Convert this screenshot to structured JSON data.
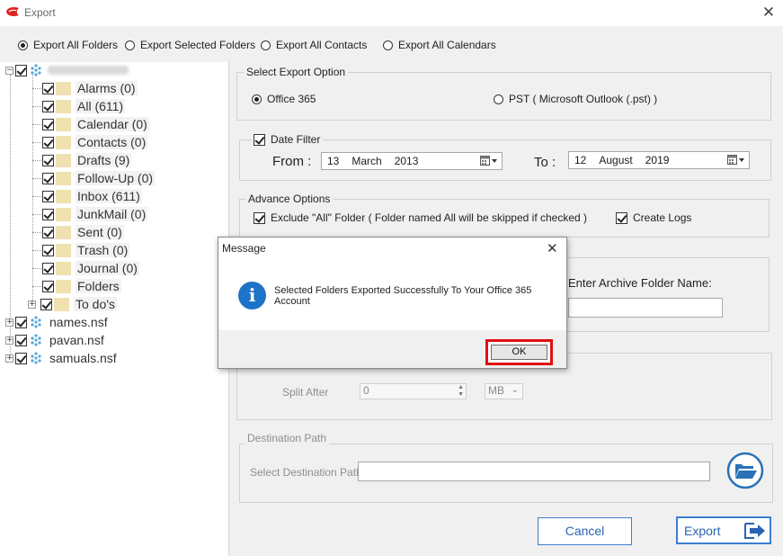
{
  "window": {
    "title": "Export",
    "icon": "app-logo-icon",
    "close_glyph": "✕"
  },
  "export_modes": [
    {
      "label": "Export All Folders",
      "selected": true
    },
    {
      "label": "Export Selected Folders",
      "selected": false
    },
    {
      "label": "Export All Contacts",
      "selected": false
    },
    {
      "label": "Export All Calendars",
      "selected": false
    }
  ],
  "tree": {
    "root": {
      "label_redacted": true,
      "checked": true,
      "expanded": true
    },
    "folders": [
      {
        "label": "Alarms (0)",
        "checked": true
      },
      {
        "label": "All (611)",
        "checked": true
      },
      {
        "label": "Calendar (0)",
        "checked": true
      },
      {
        "label": "Contacts (0)",
        "checked": true
      },
      {
        "label": "Drafts (9)",
        "checked": true
      },
      {
        "label": "Follow-Up (0)",
        "checked": true
      },
      {
        "label": "Inbox (611)",
        "checked": true
      },
      {
        "label": "JunkMail (0)",
        "checked": true
      },
      {
        "label": "Sent (0)",
        "checked": true
      },
      {
        "label": "Trash (0)",
        "checked": true
      },
      {
        "label": "Journal (0)",
        "checked": true
      },
      {
        "label": "Folders",
        "checked": true
      },
      {
        "label": "To do's",
        "checked": true,
        "expandable": true
      }
    ],
    "databases": [
      {
        "label": "names.nsf",
        "checked": true
      },
      {
        "label": "pavan.nsf",
        "checked": true
      },
      {
        "label": "samuals.nsf",
        "checked": true
      }
    ]
  },
  "export_option": {
    "legend": "Select Export Option",
    "office365_label": "Office 365",
    "office365_selected": true,
    "pst_label": "PST ( Microsoft Outlook (.pst) )",
    "pst_selected": false
  },
  "date_filter": {
    "label": "Date Filter",
    "checked": true,
    "from_label": "From :",
    "from": {
      "day": "13",
      "month": "March",
      "year": "2013"
    },
    "to_label": "To :",
    "to": {
      "day": "12",
      "month": "August",
      "year": "2019"
    }
  },
  "advance_options": {
    "legend": "Advance Options",
    "exclude_all_label": "Exclude \"All\" Folder ( Folder named All will be skipped if checked )",
    "exclude_all_checked": true,
    "create_logs_label": "Create Logs",
    "create_logs_checked": true
  },
  "archive": {
    "label": "Enter Archive Folder Name:",
    "value": ""
  },
  "split": {
    "label": "Split After",
    "value": "0",
    "unit": "MB"
  },
  "destination": {
    "legend": "Destination Path",
    "label": "Select Destination Path",
    "value": ""
  },
  "buttons": {
    "cancel": "Cancel",
    "export": "Export"
  },
  "dialog": {
    "title": "Message",
    "message_line1": "Selected Folders Exported Successfully To Your Office 365",
    "message_line2": "Account",
    "info_glyph": "i",
    "ok_label": "OK",
    "close_glyph": "✕"
  },
  "colors": {
    "accent_blue": "#2a64b0",
    "highlight_red": "#e01010",
    "info_blue": "#1e73c8"
  }
}
